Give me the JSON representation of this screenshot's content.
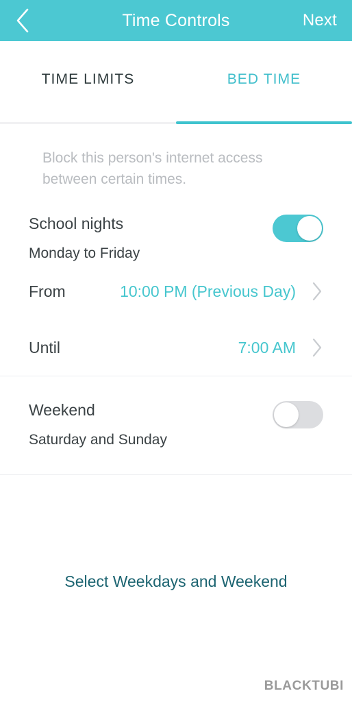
{
  "header": {
    "title": "Time Controls",
    "back_icon": "chevron-left-icon",
    "next_label": "Next"
  },
  "tabs": [
    {
      "label": "TIME LIMITS",
      "active": false
    },
    {
      "label": "BED TIME",
      "active": true
    }
  ],
  "main": {
    "description": "Block this person's internet access between certain times.",
    "school_nights": {
      "title": "School nights",
      "subtitle": "Monday to Friday",
      "toggle_state": "on"
    },
    "from_row": {
      "label": "From",
      "value": "10:00 PM (Previous Day)",
      "chevron_icon": "chevron-right-icon"
    },
    "until_row": {
      "label": "Until",
      "value": "7:00 AM",
      "chevron_icon": "chevron-right-icon"
    },
    "weekend": {
      "title": "Weekend",
      "subtitle": "Saturday and Sunday",
      "toggle_state": "off"
    },
    "select_link": "Select Weekdays and Weekend"
  },
  "watermark": "BLACKTUBI",
  "colors": {
    "accent": "#4cc8d2",
    "accent_text": "#46c6ce",
    "tab_active": "#3fbecb",
    "link": "#1c6471",
    "text_primary": "#3b4245",
    "text_muted": "#b9bcc0",
    "toggle_off": "#dcdde0",
    "divider": "#eceef0"
  }
}
